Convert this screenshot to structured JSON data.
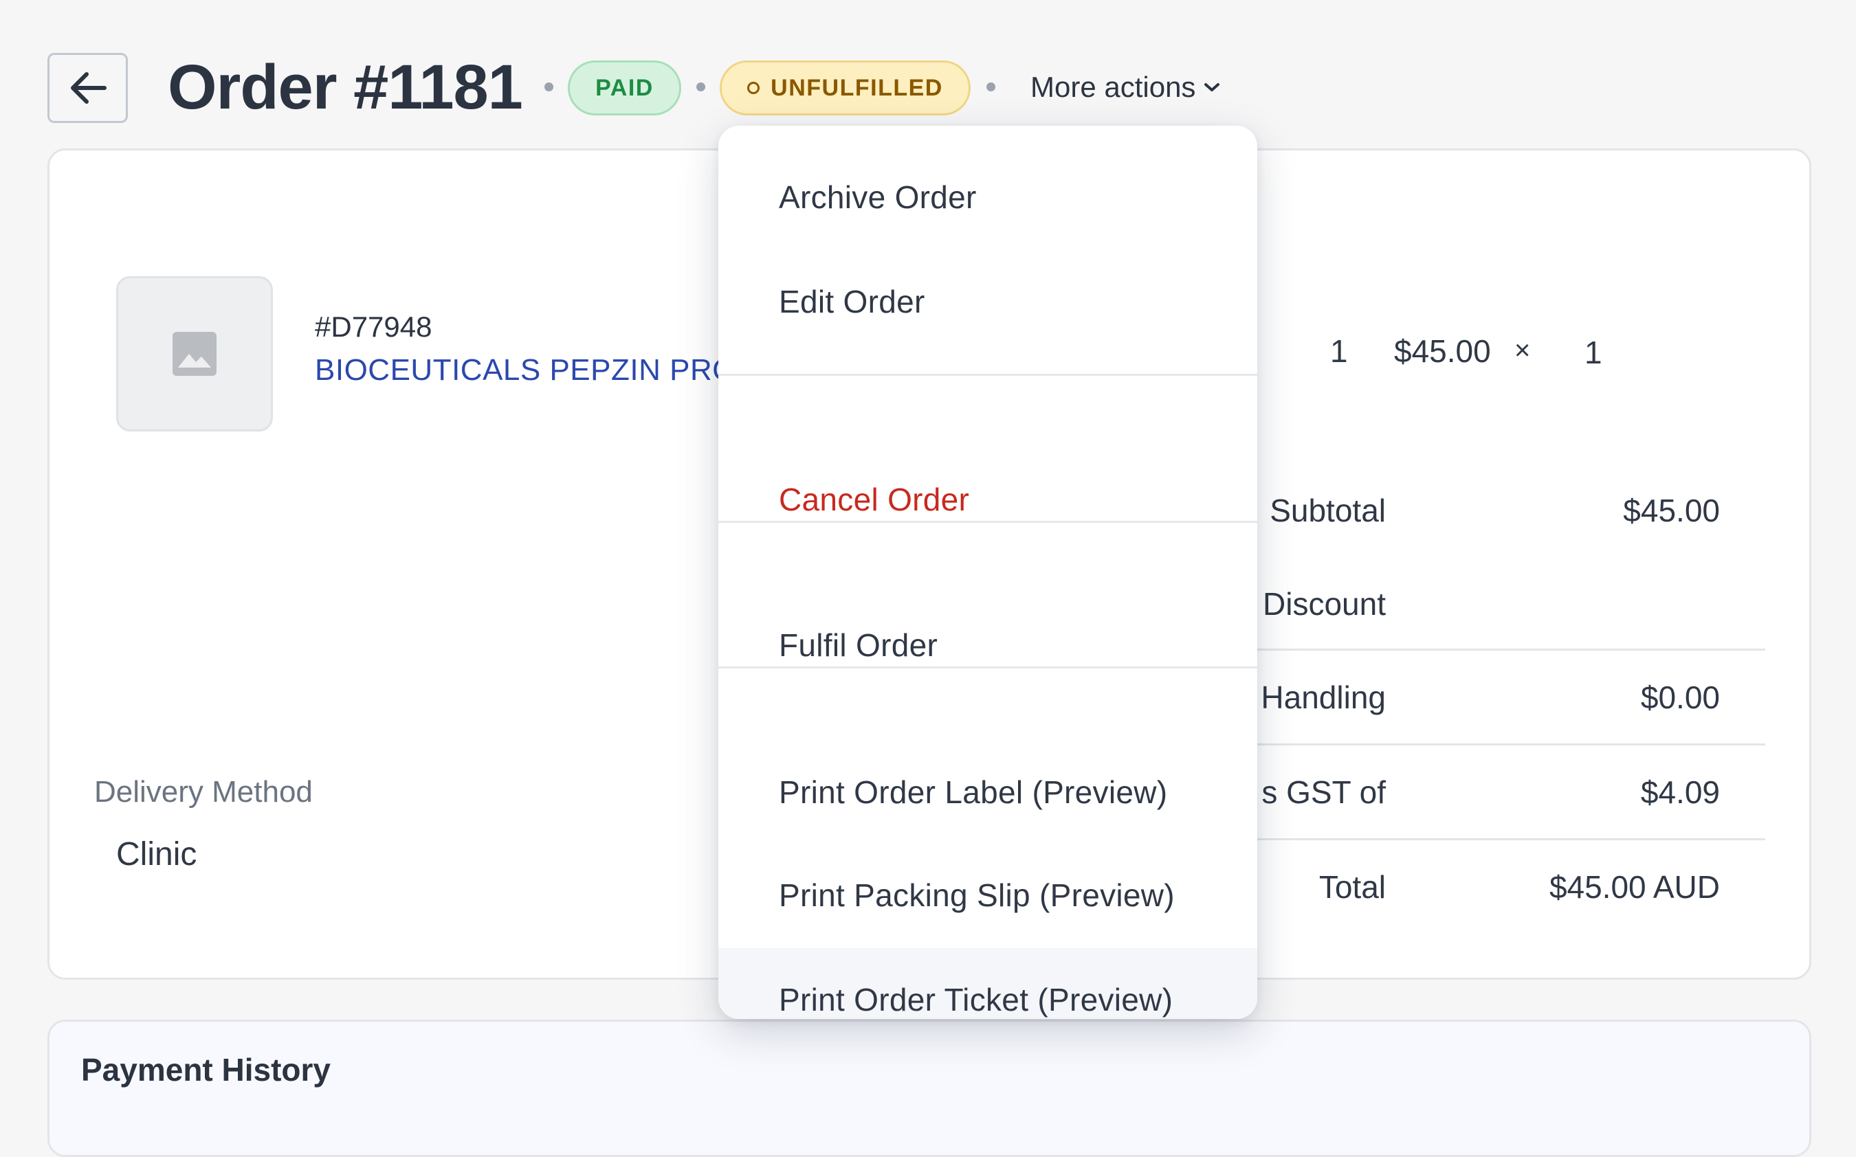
{
  "header": {
    "title": "Order #1181",
    "badges": {
      "paid": "PAID",
      "fulfillment": "UNFULFILLED"
    },
    "more_actions_label": "More actions"
  },
  "line_item": {
    "sku": "#D77948",
    "product_name": "BIOCEUTICALS PEPZIN PRO",
    "quantity": "1",
    "unit_price": "$45.00",
    "multiply_symbol": "×",
    "line_quantity": "1"
  },
  "summary": {
    "subtotal_label": "Subtotal",
    "subtotal_value": "$45.00",
    "discount_label": "Discount",
    "handling_label": "Handling",
    "handling_value": "$0.00",
    "gst_label": "s GST of",
    "gst_value": "$4.09",
    "total_label": "Total",
    "total_value": "$45.00 AUD"
  },
  "delivery": {
    "label": "Delivery Method",
    "value": "Clinic"
  },
  "payment_history": {
    "title": "Payment History"
  },
  "menu": {
    "items": [
      "Archive Order",
      "Edit Order",
      "Cancel Order",
      "Fulfil Order",
      "Print Order Label (Preview)",
      "Print Packing Slip (Preview)",
      "Print Order Ticket (Preview)"
    ]
  },
  "colors": {
    "link": "#2b48ad",
    "danger": "#c7291d",
    "paid_bg": "#d6f2df",
    "paid_text": "#1e8c43",
    "unfulfilled_bg": "#fdefbf",
    "unfulfilled_text": "#8a5800"
  }
}
